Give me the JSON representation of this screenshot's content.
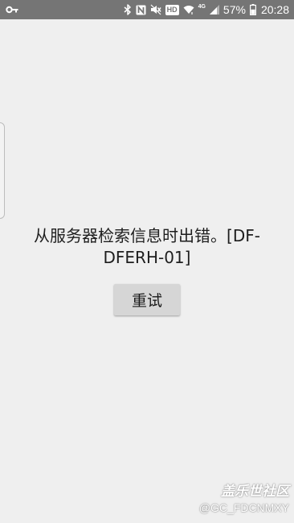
{
  "status_bar": {
    "left_icon": "key-icon",
    "right_icons": [
      "bluetooth-icon",
      "nfc-icon",
      "mute-icon",
      "hd-badge",
      "wifi-icon",
      "network-4g-icon",
      "signal-icon",
      "battery-icon"
    ],
    "hd_label": "HD",
    "network_label": "4G",
    "battery_percent": "57%",
    "time": "20:28"
  },
  "main": {
    "error_message": "从服务器检索信息时出错。[DF-DFERH-01]",
    "retry_label": "重试"
  },
  "watermark": {
    "title": "盖乐世社区",
    "user": "@GC_FDCNMXY"
  },
  "colors": {
    "status_bar_bg": "#757575",
    "page_bg": "#efefef",
    "button_bg": "#d6d6d6",
    "text": "#1e1e1e"
  }
}
